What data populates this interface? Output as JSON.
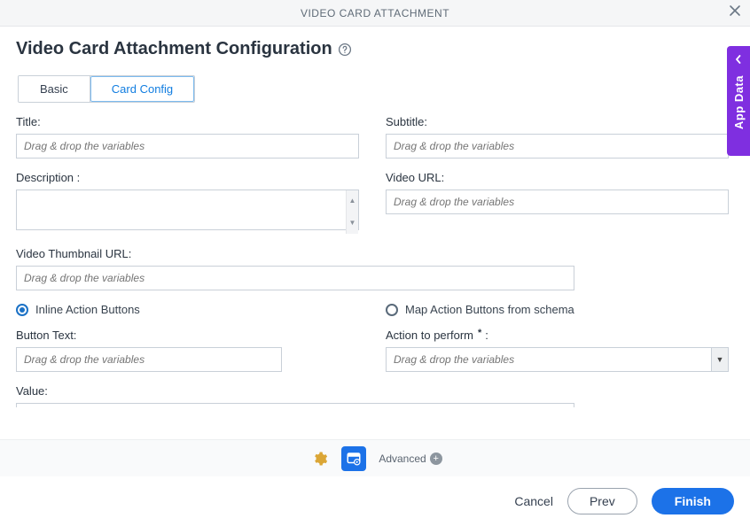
{
  "header": {
    "title": "VIDEO CARD ATTACHMENT"
  },
  "page_title": "Video Card Attachment Configuration",
  "tabs": {
    "basic": "Basic",
    "card_config": "Card Config"
  },
  "labels": {
    "title": "Title:",
    "subtitle": "Subtitle:",
    "description": "Description :",
    "video_url": "Video URL:",
    "video_thumb_url": "Video Thumbnail URL:",
    "inline_action": "Inline Action Buttons",
    "map_action": "Map Action Buttons from schema",
    "button_text": "Button Text:",
    "action_to_perform": "Action to perform",
    "value": "Value:"
  },
  "placeholders": {
    "dragdrop": "Drag & drop the variables"
  },
  "footer": {
    "advanced": "Advanced"
  },
  "actions": {
    "cancel": "Cancel",
    "prev": "Prev",
    "finish": "Finish"
  },
  "side": {
    "label": "App Data"
  }
}
